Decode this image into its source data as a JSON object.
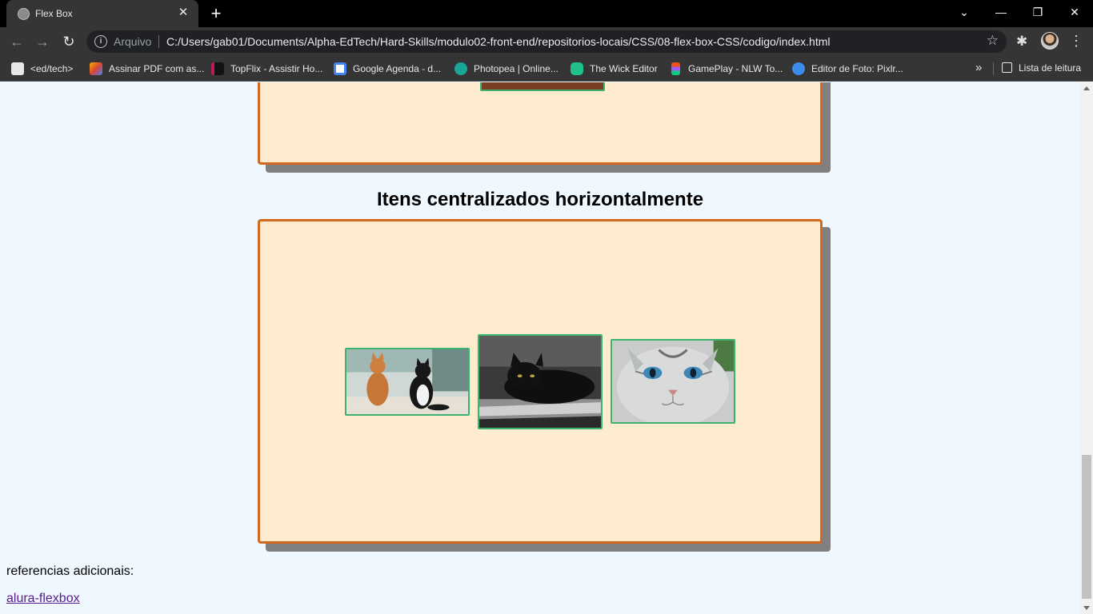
{
  "browser": {
    "tab_title": "Flex Box",
    "tab_close": "✕",
    "new_tab": "+",
    "window": {
      "minimize": "—",
      "restore": "❐",
      "close": "✕",
      "tabsearch": "⌄"
    },
    "nav": {
      "back": "←",
      "forward": "→",
      "reload": "↻"
    },
    "address": {
      "info": "i",
      "scheme_label": "Arquivo",
      "url": "C:/Users/gab01/Documents/Alpha-EdTech/Hard-Skills/modulo02-front-end/repositorios-locais/CSS/08-flex-box-CSS/codigo/index.html",
      "star": "☆"
    },
    "extensions_glyph": "✱",
    "menu_glyph": "⋮",
    "bookmarks": [
      {
        "label": "<ed/tech>",
        "color": "#e8e8e8"
      },
      {
        "label": "Assinar PDF com as...",
        "color": "#f4b400"
      },
      {
        "label": "TopFlix - Assistir Ho...",
        "color": "#c2185b"
      },
      {
        "label": "Google Agenda - d...",
        "color": "#4285f4"
      },
      {
        "label": "Photopea | Online...",
        "color": "#18a497"
      },
      {
        "label": "The Wick Editor",
        "color": "#21c18c"
      },
      {
        "label": "GamePlay - NLW To...",
        "color": "#f24e1e"
      },
      {
        "label": "Editor de Foto: Pixlr...",
        "color": "#3b8bea"
      }
    ],
    "bookmarks_overflow": "»",
    "reading_list": "Lista de leitura"
  },
  "page": {
    "section_title": "Itens centralizados horizontalmente",
    "references_label": "referencias adicionais:",
    "reference_link": "alura-flexbox"
  },
  "colors": {
    "page_bg": "#f0f8ff",
    "container_bg": "#ffebcd",
    "container_border": "#d2691e",
    "shadow": "#808080",
    "image_border": "#3cb371"
  }
}
